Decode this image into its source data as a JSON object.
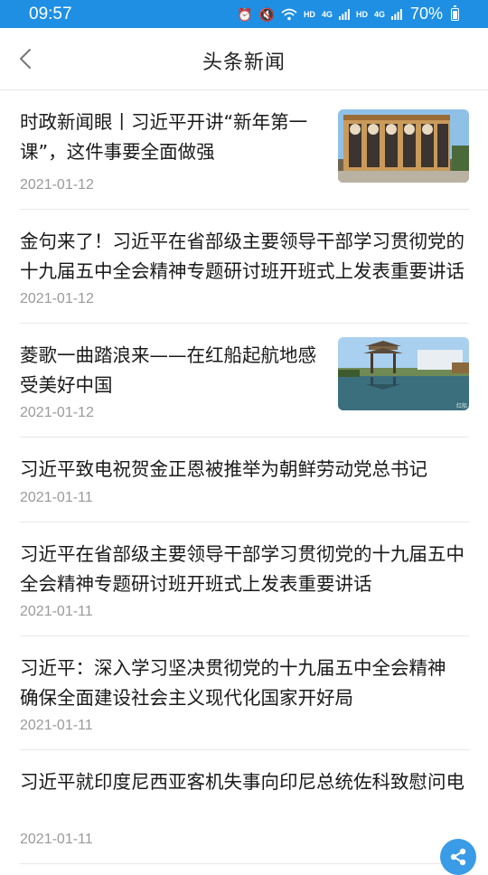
{
  "status_bar": {
    "time": "09:57",
    "hd_label_1": "HD",
    "net_label_1": "4G",
    "hd_label_2": "HD",
    "net_label_2": "4G",
    "battery": "70%"
  },
  "header": {
    "title": "头条新闻"
  },
  "news": [
    {
      "title": "时政新闻眼丨习近平开讲“新年第一课”，这件事要全面做强",
      "date": "2021-01-12",
      "thumbnail": "building-photo"
    },
    {
      "title": "金句来了！习近平在省部级主要领导干部学习贯彻党的十九届五中全会精神专题研讨班开班式上发表重要讲话",
      "date": "2021-01-12"
    },
    {
      "title": "菱歌一曲踏浪来——在红船起航地感受美好中国",
      "date": "2021-01-12",
      "thumbnail": "lake-pavilion-photo",
      "thumbnail_watermark": "红船"
    },
    {
      "title": "习近平致电祝贺金正恩被推举为朝鲜劳动党总书记",
      "date": "2021-01-11"
    },
    {
      "title": "习近平在省部级主要领导干部学习贯彻党的十九届五中全会精神专题研讨班开班式上发表重要讲话",
      "date": "2021-01-11"
    },
    {
      "title": "习近平：深入学习坚决贯彻党的十九届五中全会精神 确保全面建设社会主义现代化国家开好局",
      "date": "2021-01-11"
    },
    {
      "title": "习近平就印度尼西亚客机失事向印尼总统佐科致慰问电",
      "date": "2021-01-11"
    }
  ],
  "colors": {
    "status_bar": "#1e8fe3",
    "date_text": "#9a9a9a",
    "share_button": "#3a9be6"
  }
}
